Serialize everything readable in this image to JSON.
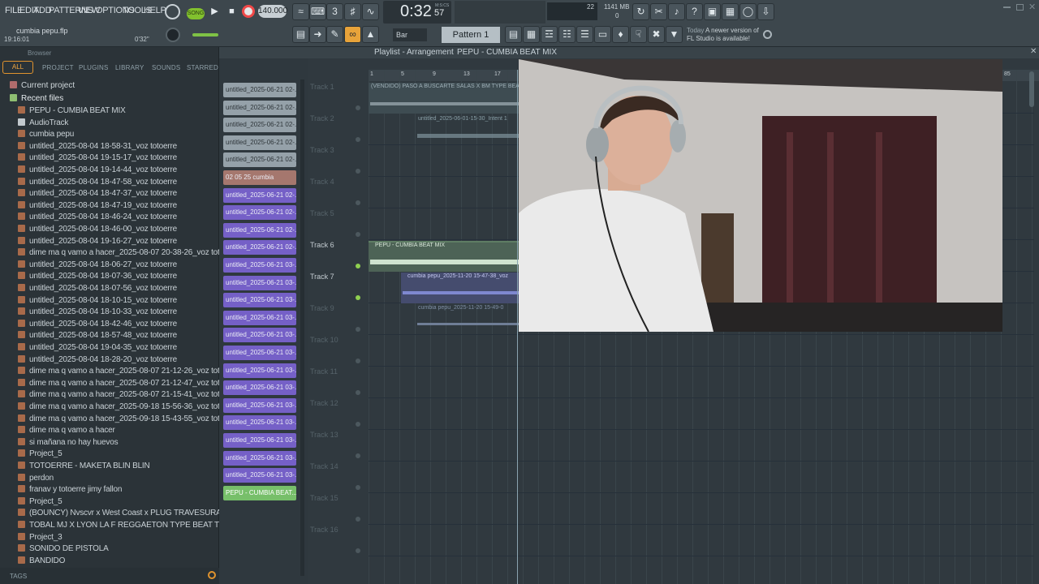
{
  "menu": [
    "FILE",
    "EDIT",
    "ADD",
    "PATTERNS",
    "VIEW",
    "OPTIONS",
    "TOOLS",
    "HELP"
  ],
  "transport": {
    "mode": "SONG",
    "tempo": "140.000",
    "time": "0:32",
    "time_sub": "57",
    "time_unit": "M:S:CS",
    "cpu": "22",
    "ram": "1141 MB",
    "voices": "0"
  },
  "project": {
    "file": "cumbia pepu.flp",
    "time": "19:16:01",
    "duration": "0'32\""
  },
  "snap": "Bar",
  "pattern": "Pattern 1",
  "news": {
    "line1": "Today",
    "line2": "A newer version of",
    "line3": "FL Studio is available!"
  },
  "browser": {
    "title": "Browser",
    "tabs": [
      "ALL",
      "PROJECT",
      "PLUGINS",
      "LIBRARY",
      "SOUNDS",
      "STARRED"
    ],
    "current": "Current project",
    "recent": "Recent files",
    "items": [
      "PEPU - CUMBIA BEAT MIX",
      "AudioTrack",
      "cumbia pepu",
      "untitled_2025-08-04 18-58-31_voz totoerre",
      "untitled_2025-08-04 19-15-17_voz totoerre",
      "untitled_2025-08-04 19-14-44_voz totoerre",
      "untitled_2025-08-04 18-47-58_voz totoerre",
      "untitled_2025-08-04 18-47-37_voz totoerre",
      "untitled_2025-08-04 18-47-19_voz totoerre",
      "untitled_2025-08-04 18-46-24_voz totoerre",
      "untitled_2025-08-04 18-46-00_voz totoerre",
      "untitled_2025-08-04 19-16-27_voz totoerre",
      "dime ma q vamo a  hacer_2025-08-07 20-38-26_voz totoerre",
      "untitled_2025-08-04 18-06-27_voz totoerre",
      "untitled_2025-08-04 18-07-36_voz totoerre",
      "untitled_2025-08-04 18-07-56_voz totoerre",
      "untitled_2025-08-04 18-10-15_voz totoerre",
      "untitled_2025-08-04 18-10-33_voz totoerre",
      "untitled_2025-08-04 18-42-46_voz totoerre",
      "untitled_2025-08-04 18-57-48_voz totoerre",
      "untitled_2025-08-04 19-04-35_voz totoerre",
      "untitled_2025-08-04 18-28-20_voz totoerre",
      "dime ma q vamo a  hacer_2025-08-07 21-12-26_voz totoerre",
      "dime ma q vamo a  hacer_2025-08-07 21-12-47_voz totoerre",
      "dime ma q vamo a  hacer_2025-08-07 21-15-41_voz totoerre",
      "dime ma q vamo a  hacer_2025-09-18 15-56-36_voz totoerre",
      "dime ma q vamo a  hacer_2025-09-18 15-43-55_voz totoerre",
      "dime ma q vamo a  hacer",
      "si mañana no hay huevos",
      "Project_5",
      "TOTOERRE - MAKETA BLIN BLIN",
      "perdon",
      "franav y totoerre jimy fallon",
      "Project_5",
      "(BOUNCY) Nvscvr x West Coast x PLUG TRAVESURAS Type Beat",
      "TOBAL MJ X LYON LA F REGGAETON TYPE BEAT TE ROBE",
      "Project_3",
      "SONIDO DE PISTOLA",
      "BANDIDO"
    ],
    "tags": "TAGS"
  },
  "clips": [
    "untitled_2025-06-21 02-...",
    "untitled_2025-06-21 02-...",
    "untitled_2025-06-21 02-...",
    "untitled_2025-06-21 02-...",
    "untitled_2025-06-21 02-...",
    "02 05 25 cumbia",
    "untitled_2025-06-21 02-...",
    "untitled_2025-06-21 02-...",
    "untitled_2025-06-21 02-...",
    "untitled_2025-06-21 02-...",
    "untitled_2025-06-21 03-...",
    "untitled_2025-06-21 03-...",
    "untitled_2025-06-21 03-...",
    "untitled_2025-06-21 03-...",
    "untitled_2025-06-21 03-...",
    "untitled_2025-06-21 03-...",
    "untitled_2025-06-21 03-...",
    "untitled_2025-06-21 03-...",
    "untitled_2025-06-21 03-...",
    "untitled_2025-06-21 03-...",
    "untitled_2025-06-21 03-...",
    "untitled_2025-06-21 03-...",
    "untitled_2025-06-21 03-...",
    "PEPU - CUMBIA BEAT..."
  ],
  "playlist": {
    "title": "Playlist - Arrangement",
    "pattern": "PEPU - CUMBIA BEAT MIX",
    "ruler": [
      "1",
      "5",
      "9",
      "13",
      "17",
      "85"
    ],
    "tracks": [
      "Track 1",
      "Track 2",
      "Track 3",
      "Track 4",
      "Track 5",
      "Track 6",
      "Track 7",
      "Track 9",
      "Track 10",
      "Track 11",
      "Track 12",
      "Track 13",
      "Track 14",
      "Track 15",
      "Track 16"
    ],
    "clip_labels": [
      "(VENDIDO) PASO A BUSCARTE SALAS X BM TYPE BEAT",
      "untitled_2025-06-01-15-30_Intent 1",
      "PEPU - CUMBIA BEAT MIX",
      "cumbia pepu_2025-11-20 15-47-38_voz",
      "cumbia pepu_2025-11-20 15-49-0"
    ]
  }
}
